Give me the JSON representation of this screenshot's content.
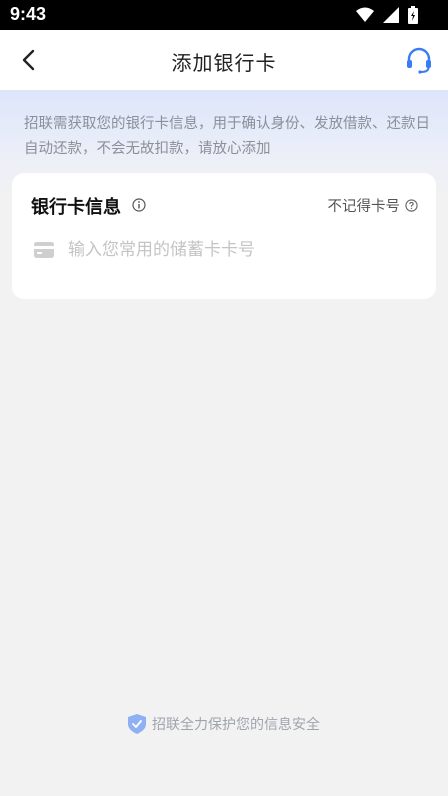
{
  "status_bar": {
    "time": "9:43"
  },
  "nav": {
    "title": "添加银行卡"
  },
  "notice": {
    "text": "招联需获取您的银行卡信息，用于确认身份、发放借款、还款日自动还款，不会无故扣款，请放心添加"
  },
  "card": {
    "title": "银行卡信息",
    "forgot_label": "不记得卡号",
    "card_number_placeholder": "输入您常用的储蓄卡卡号",
    "card_number_value": ""
  },
  "footer": {
    "security_text": "招联全力保护您的信息安全"
  },
  "colors": {
    "accent": "#3a7bf6",
    "shield": "#8fb1f4"
  }
}
